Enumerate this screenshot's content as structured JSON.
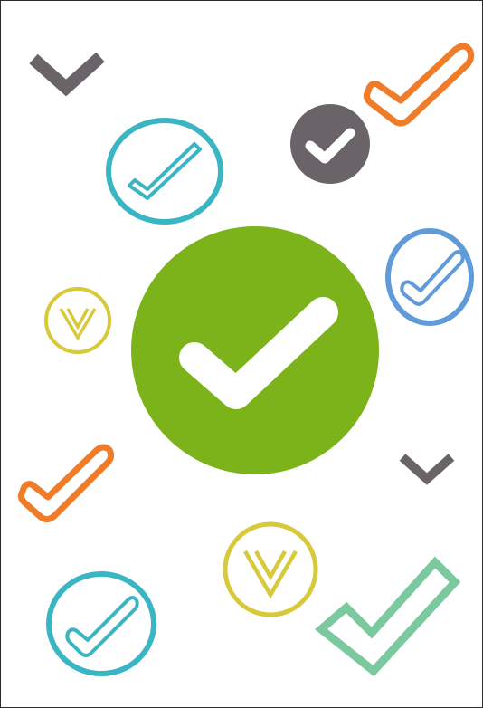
{
  "colors": {
    "background": "#ffffff",
    "frame": "#2b2b2b",
    "green": "#7cb31b",
    "orange": "#f07c2a",
    "teal": "#3ab5c4",
    "blue": "#5e9bd8",
    "yellow": "#d7c93a",
    "mint": "#7cc9a0",
    "dark_gray": "#6a6468",
    "white": "#ffffff"
  },
  "icons": [
    "chevron-down-icon",
    "checkmark-outline-icon",
    "checkmark-circle-outline-icon",
    "checkmark-circle-filled-icon",
    "chevron-circle-outline-icon",
    "checkmark-circle-large-filled-icon",
    "chevron-down-icon",
    "checkmark-outline-icon"
  ]
}
